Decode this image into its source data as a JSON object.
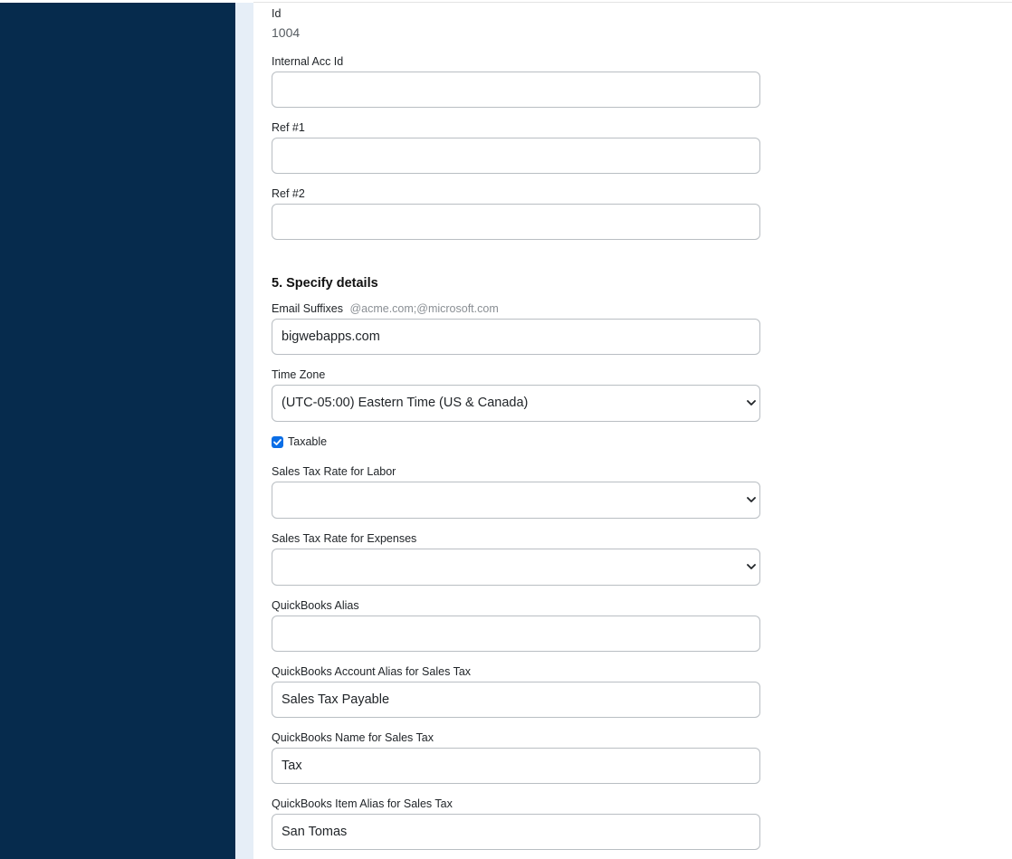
{
  "form": {
    "id": {
      "label": "Id",
      "value": "1004"
    },
    "internal_acc_id": {
      "label": "Internal Acc Id",
      "value": ""
    },
    "ref1": {
      "label": "Ref #1",
      "value": ""
    },
    "ref2": {
      "label": "Ref #2",
      "value": ""
    },
    "section_title": "5. Specify details",
    "email_suffixes": {
      "label": "Email Suffixes",
      "hint": "@acme.com;@microsoft.com",
      "value": "bigwebapps.com"
    },
    "time_zone": {
      "label": "Time Zone",
      "selected": "(UTC-05:00) Eastern Time (US & Canada)"
    },
    "taxable": {
      "label": "Taxable",
      "checked": true
    },
    "sales_tax_labor": {
      "label": "Sales Tax Rate for Labor",
      "selected": ""
    },
    "sales_tax_expenses": {
      "label": "Sales Tax Rate for Expenses",
      "selected": ""
    },
    "qb_alias": {
      "label": "QuickBooks Alias",
      "value": ""
    },
    "qb_account_alias": {
      "label": "QuickBooks Account Alias for Sales Tax",
      "value": "Sales Tax Payable"
    },
    "qb_name": {
      "label": "QuickBooks Name for Sales Tax",
      "value": "Tax"
    },
    "qb_item_alias": {
      "label": "QuickBooks Item Alias for Sales Tax",
      "value": "San Tomas"
    }
  },
  "colors": {
    "sidebar": "#062b4d",
    "gutter": "#e6eef7",
    "checkbox": "#0b6ee6"
  },
  "icons": {
    "select_arrow": "chevron-down-icon",
    "checkbox_mark": "check-icon"
  }
}
